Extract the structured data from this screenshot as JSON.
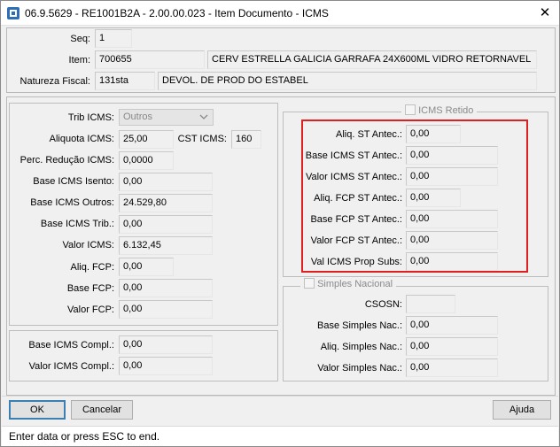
{
  "window": {
    "title": "06.9.5629 - RE1001B2A - 2.00.00.023 - Item Documento - ICMS"
  },
  "header": {
    "seq_label": "Seq:",
    "seq_value": "1",
    "item_label": "Item:",
    "item_code": "700655",
    "item_desc": "CERV ESTRELLA GALICIA GARRAFA 24X600ML VIDRO RETORNAVEL",
    "natureza_label": "Natureza Fiscal:",
    "natureza_code": "131sta",
    "natureza_desc": "DEVOL. DE PROD DO ESTABEL"
  },
  "left": {
    "trib_label": "Trib ICMS:",
    "trib_value": "Outros",
    "aliquota_label": "Aliquota ICMS:",
    "aliquota_value": "25,00",
    "cst_label": "CST ICMS:",
    "cst_value": "160",
    "perc_label": "Perc. Redução ICMS:",
    "perc_value": "0,0000",
    "base_isento_label": "Base ICMS Isento:",
    "base_isento_value": "0,00",
    "base_outros_label": "Base ICMS Outros:",
    "base_outros_value": "24.529,80",
    "base_trib_label": "Base ICMS Trib.:",
    "base_trib_value": "0,00",
    "valor_icms_label": "Valor ICMS:",
    "valor_icms_value": "6.132,45",
    "aliq_fcp_label": "Aliq. FCP:",
    "aliq_fcp_value": "0,00",
    "base_fcp_label": "Base FCP:",
    "base_fcp_value": "0,00",
    "valor_fcp_label": "Valor FCP:",
    "valor_fcp_value": "0,00"
  },
  "compl": {
    "base_label": "Base ICMS Compl.:",
    "base_value": "0,00",
    "valor_label": "Valor ICMS Compl.:",
    "valor_value": "0,00"
  },
  "retido": {
    "title": "ICMS Retido",
    "aliq_st_label": "Aliq. ST Antec.:",
    "aliq_st_value": "0,00",
    "base_st_label": "Base ICMS ST Antec.:",
    "base_st_value": "0,00",
    "valor_st_label": "Valor ICMS ST Antec.:",
    "valor_st_value": "0,00",
    "aliq_fcp_st_label": "Aliq. FCP ST Antec.:",
    "aliq_fcp_st_value": "0,00",
    "base_fcp_st_label": "Base FCP ST Antec.:",
    "base_fcp_st_value": "0,00",
    "valor_fcp_st_label": "Valor FCP ST Antec.:",
    "valor_fcp_st_value": "0,00",
    "val_prop_label": "Val ICMS Prop Subs:",
    "val_prop_value": "0,00"
  },
  "simples": {
    "title": "Simples Nacional",
    "csosn_label": "CSOSN:",
    "csosn_value": "",
    "base_label": "Base Simples Nac.:",
    "base_value": "0,00",
    "aliq_label": "Aliq. Simples Nac.:",
    "aliq_value": "0,00",
    "valor_label": "Valor Simples Nac.:",
    "valor_value": "0,00"
  },
  "buttons": {
    "ok": "OK",
    "cancelar": "Cancelar",
    "ajuda": "Ajuda"
  },
  "status": "Enter data or press ESC to end.",
  "colors": {
    "highlight_border": "#e02020",
    "default_button_border": "#3c7fb1"
  }
}
